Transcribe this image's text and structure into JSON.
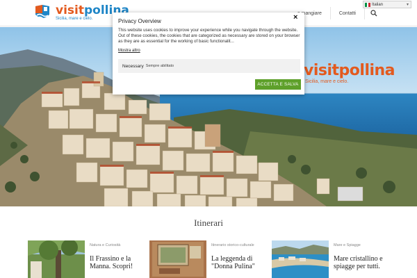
{
  "header": {
    "logo": {
      "brand_left": "visit",
      "brand_right": "pollina",
      "tagline": "Sicilia, mare e cielo."
    },
    "nav": [
      {
        "label": "...e mangiare"
      },
      {
        "label": "Contatti"
      }
    ],
    "language": {
      "selected": "Italian"
    }
  },
  "hero": {
    "overlay_logo": {
      "word": "visitpollina",
      "tagline": "Sicilia, mare e cielo."
    }
  },
  "cookie": {
    "title": "Privacy Overview",
    "close_label": "×",
    "body": "This website uses cookies to improve your experience while you navigate through the website. Out of these cookies, the cookies that are categorized as necessary are stored on your browser as they are as essential for the working of basic functionalit...",
    "more_label": "Mostra altro",
    "necessary_label": "Necessary",
    "necessary_status": "Sempre abilitato",
    "accept_label": "ACCETTA E SALVA"
  },
  "section": {
    "title": "Itinerari"
  },
  "cards": [
    {
      "category": "Natura e Curiosità",
      "title": "Il Frassino e la Manna. Scopri!"
    },
    {
      "category": "Itinerario storico-culturale",
      "title": "La leggenda di \"Donna Pulina\""
    },
    {
      "category": "Mare e Spiagge",
      "title": "Mare cristallino e spiagge per tutti."
    }
  ],
  "colors": {
    "brand_orange": "#e35a1e",
    "brand_blue": "#1f86c7",
    "accept_green": "#5ea02a"
  }
}
